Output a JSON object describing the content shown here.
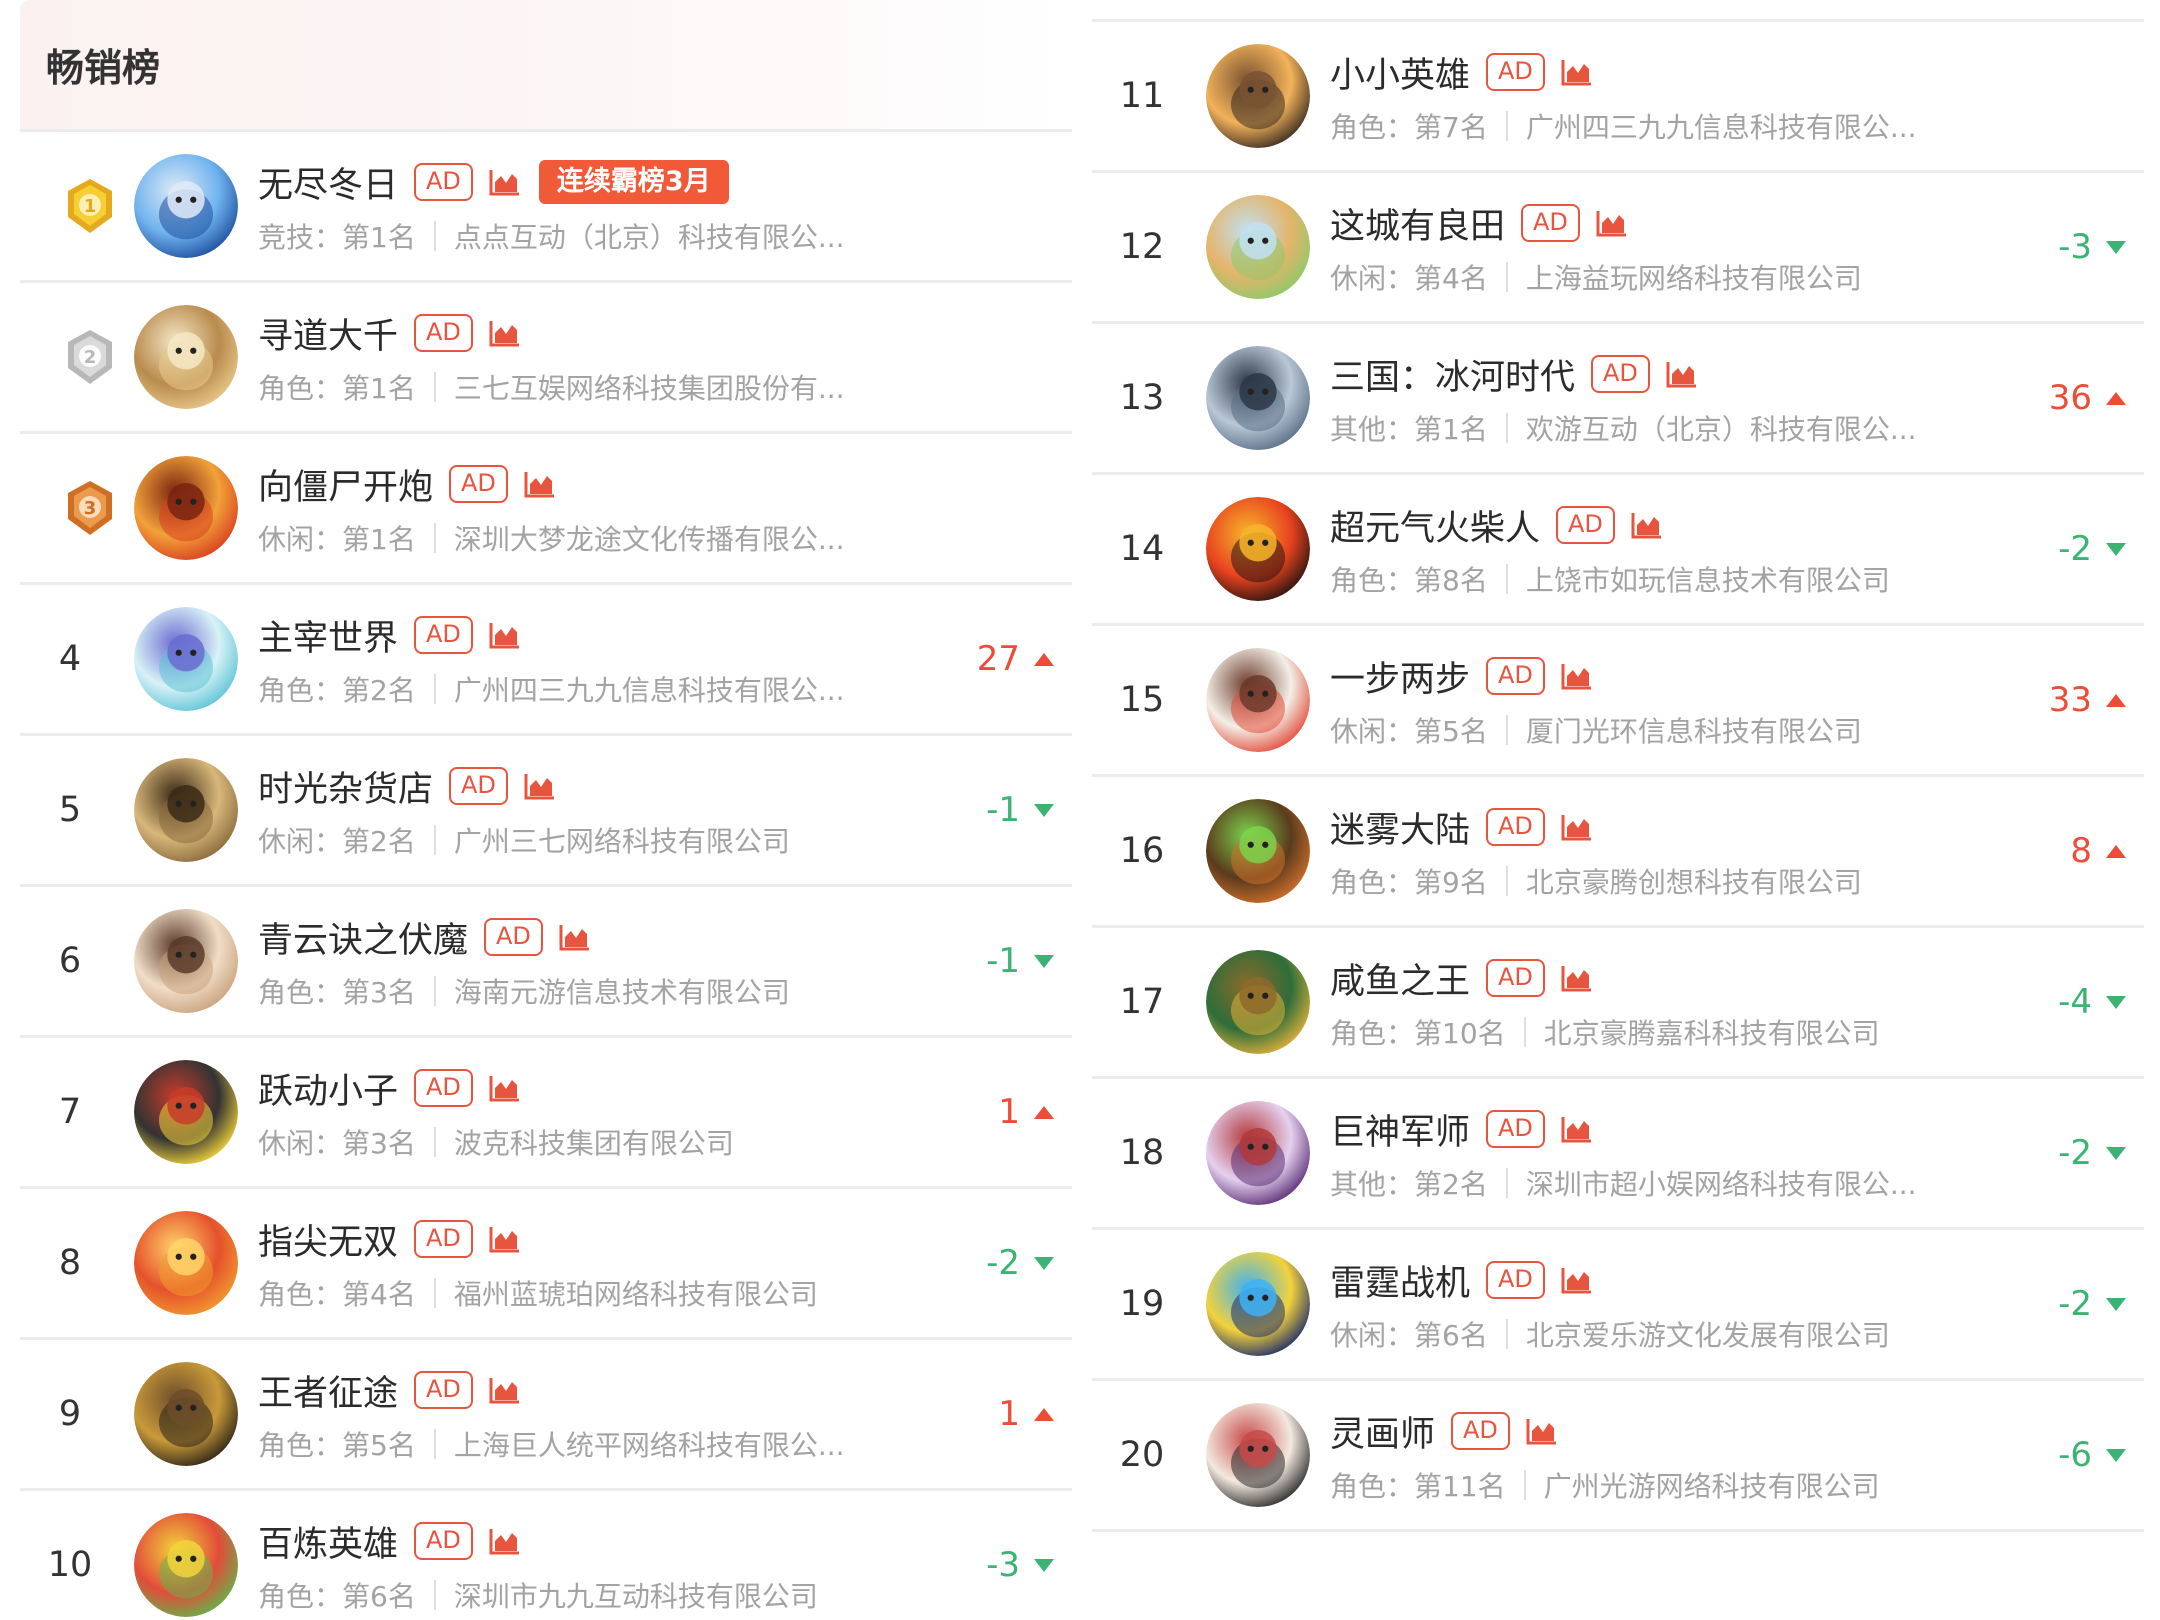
{
  "header": {
    "title": "畅销榜"
  },
  "colors": {
    "accent": "#e8553f",
    "up": "#ee4c37",
    "down": "#3cb372",
    "gold": "#f2c230",
    "silver": "#cfcfcf",
    "bronze": "#e58b3e"
  },
  "left_list": [
    {
      "rank": "1",
      "medal": "gold-medal-icon",
      "name": "无尽冬日",
      "ad": "AD",
      "streak": "连续霸榜3月",
      "category": "竞技：第1名",
      "company": "点点互动（北京）科技有限公...",
      "change": "",
      "direction": ""
    },
    {
      "rank": "2",
      "medal": "silver-medal-icon",
      "name": "寻道大千",
      "ad": "AD",
      "category": "角色：第1名",
      "company": "三七互娱网络科技集团股份有...",
      "change": "",
      "direction": ""
    },
    {
      "rank": "3",
      "medal": "bronze-medal-icon",
      "name": "向僵尸开炮",
      "ad": "AD",
      "category": "休闲：第1名",
      "company": "深圳大梦龙途文化传播有限公...",
      "change": "",
      "direction": ""
    },
    {
      "rank": "4",
      "name": "主宰世界",
      "ad": "AD",
      "category": "角色：第2名",
      "company": "广州四三九九信息科技有限公...",
      "change": "27",
      "direction": "up"
    },
    {
      "rank": "5",
      "name": "时光杂货店",
      "ad": "AD",
      "category": "休闲：第2名",
      "company": "广州三七网络科技有限公司",
      "change": "-1",
      "direction": "down"
    },
    {
      "rank": "6",
      "name": "青云诀之伏魔",
      "ad": "AD",
      "category": "角色：第3名",
      "company": "海南元游信息技术有限公司",
      "change": "-1",
      "direction": "down"
    },
    {
      "rank": "7",
      "name": "跃动小子",
      "ad": "AD",
      "category": "休闲：第3名",
      "company": "波克科技集团有限公司",
      "change": "1",
      "direction": "up"
    },
    {
      "rank": "8",
      "name": "指尖无双",
      "ad": "AD",
      "category": "角色：第4名",
      "company": "福州蓝琥珀网络科技有限公司",
      "change": "-2",
      "direction": "down"
    },
    {
      "rank": "9",
      "name": "王者征途",
      "ad": "AD",
      "category": "角色：第5名",
      "company": "上海巨人统平网络科技有限公...",
      "change": "1",
      "direction": "up"
    },
    {
      "rank": "10",
      "name": "百炼英雄",
      "ad": "AD",
      "category": "角色：第6名",
      "company": "深圳市九九互动科技有限公司",
      "change": "-3",
      "direction": "down"
    }
  ],
  "right_list": [
    {
      "rank": "11",
      "name": "小小英雄",
      "ad": "AD",
      "category": "角色：第7名",
      "company": "广州四三九九信息科技有限公...",
      "change": "",
      "direction": ""
    },
    {
      "rank": "12",
      "name": "这城有良田",
      "ad": "AD",
      "category": "休闲：第4名",
      "company": "上海益玩网络科技有限公司",
      "change": "-3",
      "direction": "down"
    },
    {
      "rank": "13",
      "name": "三国：冰河时代",
      "ad": "AD",
      "category": "其他：第1名",
      "company": "欢游互动（北京）科技有限公...",
      "change": "36",
      "direction": "up"
    },
    {
      "rank": "14",
      "name": "超元气火柴人",
      "ad": "AD",
      "category": "角色：第8名",
      "company": "上饶市如玩信息技术有限公司",
      "change": "-2",
      "direction": "down"
    },
    {
      "rank": "15",
      "name": "一步两步",
      "ad": "AD",
      "category": "休闲：第5名",
      "company": "厦门光环信息科技有限公司",
      "change": "33",
      "direction": "up"
    },
    {
      "rank": "16",
      "name": "迷雾大陆",
      "ad": "AD",
      "category": "角色：第9名",
      "company": "北京豪腾创想科技有限公司",
      "change": "8",
      "direction": "up"
    },
    {
      "rank": "17",
      "name": "咸鱼之王",
      "ad": "AD",
      "category": "角色：第10名",
      "company": "北京豪腾嘉科科技有限公司",
      "change": "-4",
      "direction": "down"
    },
    {
      "rank": "18",
      "name": "巨神军师",
      "ad": "AD",
      "category": "其他：第2名",
      "company": "深圳市超小娱网络科技有限公...",
      "change": "-2",
      "direction": "down"
    },
    {
      "rank": "19",
      "name": "雷霆战机",
      "ad": "AD",
      "category": "休闲：第6名",
      "company": "北京爱乐游文化发展有限公司",
      "change": "-2",
      "direction": "down"
    },
    {
      "rank": "20",
      "name": "灵画师",
      "ad": "AD",
      "category": "角色：第11名",
      "company": "广州光游网络科技有限公司",
      "change": "-6",
      "direction": "down"
    }
  ]
}
